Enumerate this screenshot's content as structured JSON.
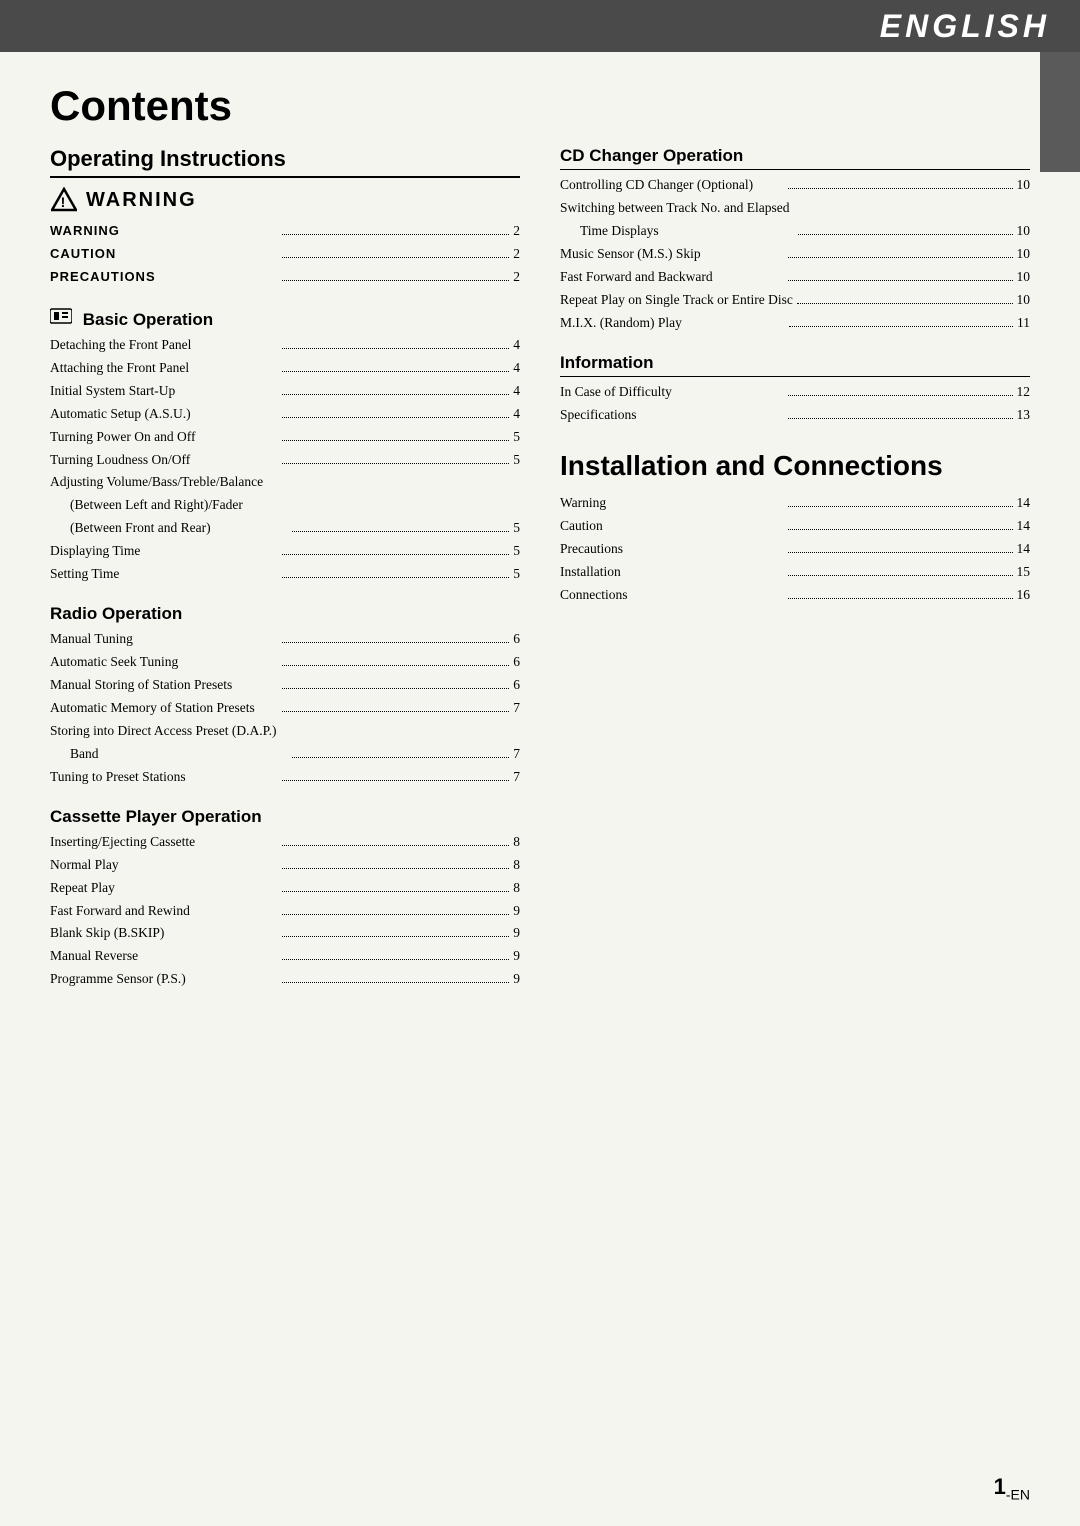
{
  "header": {
    "title": "ENGLISH"
  },
  "page_title": "Contents",
  "left_column": {
    "section1_heading": "Operating Instructions",
    "warning_heading": "WARNING",
    "warning_entries": [
      {
        "label": "WARNING",
        "dots": true,
        "page": "2"
      },
      {
        "label": "CAUTION",
        "dots": true,
        "page": "2"
      },
      {
        "label": "PRECAUTIONS",
        "dots": true,
        "page": "2"
      }
    ],
    "section2_heading": "Basic Operation",
    "basic_entries": [
      {
        "label": "Detaching the Front Panel",
        "dots": true,
        "page": "4",
        "indent": 0
      },
      {
        "label": "Attaching the Front Panel",
        "dots": true,
        "page": "4",
        "indent": 0
      },
      {
        "label": "Initial System Start-Up",
        "dots": true,
        "page": "4",
        "indent": 0
      },
      {
        "label": "Automatic Setup (A.S.U.)",
        "dots": true,
        "page": "4",
        "indent": 0
      },
      {
        "label": "Turning Power On and Off",
        "dots": true,
        "page": "5",
        "indent": 0
      },
      {
        "label": "Turning Loudness On/Off",
        "dots": true,
        "page": "5",
        "indent": 0
      },
      {
        "label": "Adjusting Volume/Bass/Treble/Balance",
        "dots": false,
        "page": "",
        "indent": 0
      },
      {
        "label": "(Between Left and Right)/Fader",
        "dots": false,
        "page": "",
        "indent": 1
      },
      {
        "label": "(Between Front and Rear)",
        "dots": true,
        "page": "5",
        "indent": 1
      },
      {
        "label": "Displaying Time",
        "dots": true,
        "page": "5",
        "indent": 0
      },
      {
        "label": "Setting Time",
        "dots": true,
        "page": "5",
        "indent": 0
      }
    ],
    "radio_heading": "Radio Operation",
    "radio_entries": [
      {
        "label": "Manual Tuning",
        "dots": true,
        "page": "6",
        "indent": 0
      },
      {
        "label": "Automatic Seek Tuning",
        "dots": true,
        "page": "6",
        "indent": 0
      },
      {
        "label": "Manual Storing of Station Presets",
        "dots": true,
        "page": "6",
        "indent": 0
      },
      {
        "label": "Automatic Memory of Station Presets",
        "dots": true,
        "page": "7",
        "indent": 0
      },
      {
        "label": "Storing into Direct Access Preset (D.A.P.)",
        "dots": false,
        "page": "",
        "indent": 0
      },
      {
        "label": "Band",
        "dots": true,
        "page": "7",
        "indent": 1
      },
      {
        "label": "Tuning to Preset Stations",
        "dots": true,
        "page": "7",
        "indent": 0
      }
    ],
    "cassette_heading": "Cassette Player Operation",
    "cassette_entries": [
      {
        "label": "Inserting/Ejecting Cassette",
        "dots": true,
        "page": "8",
        "indent": 0
      },
      {
        "label": "Normal Play",
        "dots": true,
        "page": "8",
        "indent": 0
      },
      {
        "label": "Repeat Play",
        "dots": true,
        "page": "8",
        "indent": 0
      },
      {
        "label": "Fast Forward and Rewind",
        "dots": true,
        "page": "9",
        "indent": 0
      },
      {
        "label": "Blank Skip (B.SKIP)",
        "dots": true,
        "page": "9",
        "indent": 0
      },
      {
        "label": "Manual Reverse",
        "dots": true,
        "page": "9",
        "indent": 0
      },
      {
        "label": "Programme Sensor (P.S.)",
        "dots": true,
        "page": "9",
        "indent": 0
      }
    ]
  },
  "right_column": {
    "cd_heading": "CD Changer Operation",
    "cd_entries": [
      {
        "label": "Controlling CD Changer (Optional)",
        "dots": true,
        "page": "10",
        "indent": 0
      },
      {
        "label": "Switching between Track No. and Elapsed",
        "dots": false,
        "page": "",
        "indent": 0
      },
      {
        "label": "Time Displays",
        "dots": true,
        "page": "10",
        "indent": 1
      },
      {
        "label": "Music Sensor (M.S.) Skip",
        "dots": true,
        "page": "10",
        "indent": 0
      },
      {
        "label": "Fast Forward and Backward",
        "dots": true,
        "page": "10",
        "indent": 0
      },
      {
        "label": "Repeat Play on Single Track or Entire Disc",
        "dots": true,
        "page": "10",
        "indent": 0
      },
      {
        "label": "M.I.X. (Random) Play",
        "dots": true,
        "page": "11",
        "indent": 0
      }
    ],
    "info_heading": "Information",
    "info_entries": [
      {
        "label": "In Case of Difficulty",
        "dots": true,
        "page": "12",
        "indent": 0
      },
      {
        "label": "Specifications",
        "dots": true,
        "page": "13",
        "indent": 0
      }
    ],
    "install_heading": "Installation and Connections",
    "install_entries": [
      {
        "label": "Warning",
        "dots": true,
        "page": "14",
        "indent": 0
      },
      {
        "label": "Caution",
        "dots": true,
        "page": "14",
        "indent": 0
      },
      {
        "label": "Precautions",
        "dots": true,
        "page": "14",
        "indent": 0
      },
      {
        "label": "Installation",
        "dots": true,
        "page": "15",
        "indent": 0
      },
      {
        "label": "Connections",
        "dots": true,
        "page": "16",
        "indent": 0
      }
    ]
  },
  "page_number": "1",
  "page_suffix": "-EN"
}
